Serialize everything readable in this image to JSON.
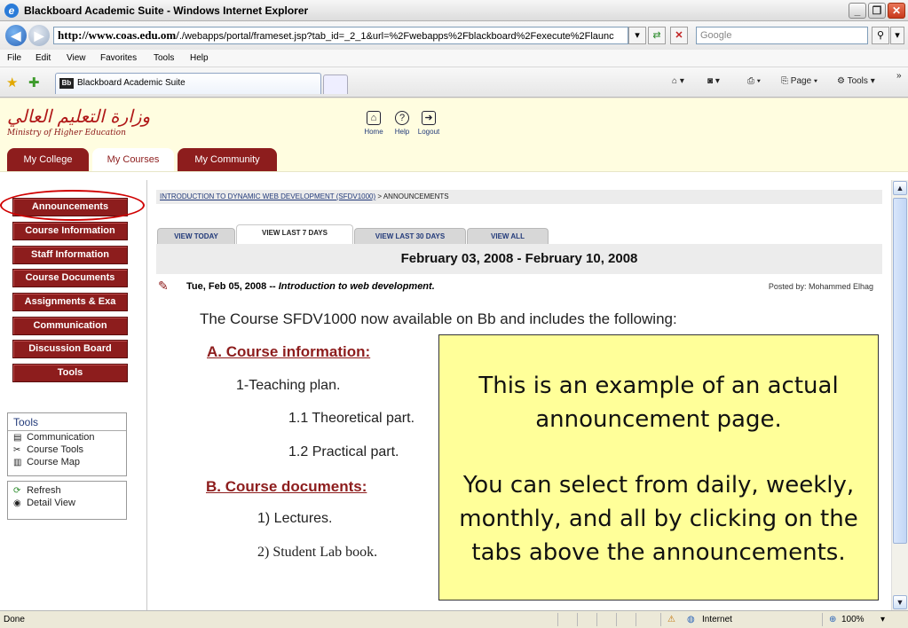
{
  "window": {
    "title": "Blackboard Academic Suite - Windows Internet Explorer"
  },
  "address_bar": {
    "url_host": "http://www.coas.edu.om/",
    "url_path": "./webapps/portal/frameset.jsp?tab_id=_2_1&url=%2Fwebapps%2Fblackboard%2Fexecute%2Flaunc",
    "search_placeholder": "Google"
  },
  "menu": [
    "File",
    "Edit",
    "View",
    "Favorites",
    "Tools",
    "Help"
  ],
  "tab": {
    "label": "Blackboard Academic Suite",
    "favicon_text": "Bb"
  },
  "command_bar": {
    "page_label": "Page",
    "tools_label": "Tools"
  },
  "header": {
    "logo_text": "وزارة التعليم العالي",
    "logo_subtitle": "Ministry of Higher Education",
    "links": [
      {
        "label": "Home",
        "icon": "home-icon"
      },
      {
        "label": "Help",
        "icon": "help-icon"
      },
      {
        "label": "Logout",
        "icon": "logout-icon"
      }
    ],
    "tabs": [
      {
        "label": "My College",
        "active": false
      },
      {
        "label": "My Courses",
        "active": true
      },
      {
        "label": "My Community",
        "active": false
      }
    ]
  },
  "course_menu": [
    "Announcements",
    "Course Information",
    "Staff Information",
    "Course Documents",
    "Assignments & Exa",
    "Communication",
    "Discussion Board",
    "Tools"
  ],
  "tools_box": {
    "heading": "Tools",
    "items": [
      {
        "label": "Communication",
        "icon": "communication-icon"
      },
      {
        "label": "Course Tools",
        "icon": "course-tools-icon"
      },
      {
        "label": "Course Map",
        "icon": "course-map-icon"
      }
    ]
  },
  "view_box": {
    "items": [
      {
        "label": "Refresh",
        "icon": "refresh-icon"
      },
      {
        "label": "Detail View",
        "icon": "detail-view-icon"
      }
    ]
  },
  "breadcrumb": {
    "course": "INTRODUCTION TO DYNAMIC WEB DEVELOPMENT (SFDV1000)",
    "separator": " > ",
    "current": "ANNOUNCEMENTS"
  },
  "view_tabs": [
    {
      "label": "VIEW TODAY",
      "active": false
    },
    {
      "label": "VIEW LAST 7 DAYS",
      "active": true
    },
    {
      "label": "VIEW LAST 30 DAYS",
      "active": false
    },
    {
      "label": "VIEW ALL",
      "active": false
    }
  ],
  "date_range": "February 03, 2008 - February 10, 2008",
  "announcement": {
    "date": "Tue, Feb 05, 2008",
    "dash": " -- ",
    "title": "Introduction to web development.",
    "posted_by": "Posted by: Mohammed Elhag",
    "intro": "The Course SFDV1000 now available on Bb and includes the following:",
    "section_a": "A. Course information:",
    "item_1": "1-Teaching plan.",
    "item_1_1": "1.1 Theoretical part.",
    "item_1_2": "1.2 Practical part.",
    "section_b": "B. Course documents:",
    "item_b1": "1) Lectures.",
    "item_b2": "2) Student Lab book."
  },
  "callout": {
    "line1": "This is an example of an actual announcement page.",
    "line2": "You can select from daily, weekly, monthly, and all by clicking on the tabs above the announcements."
  },
  "status_bar": {
    "status": "Done",
    "zone": "Internet",
    "zoom": "100%"
  },
  "colors": {
    "accent_maroon": "#8d1d1d",
    "header_bg": "#fffde0",
    "callout_bg": "#ffff99",
    "highlight_red": "#d00000"
  }
}
